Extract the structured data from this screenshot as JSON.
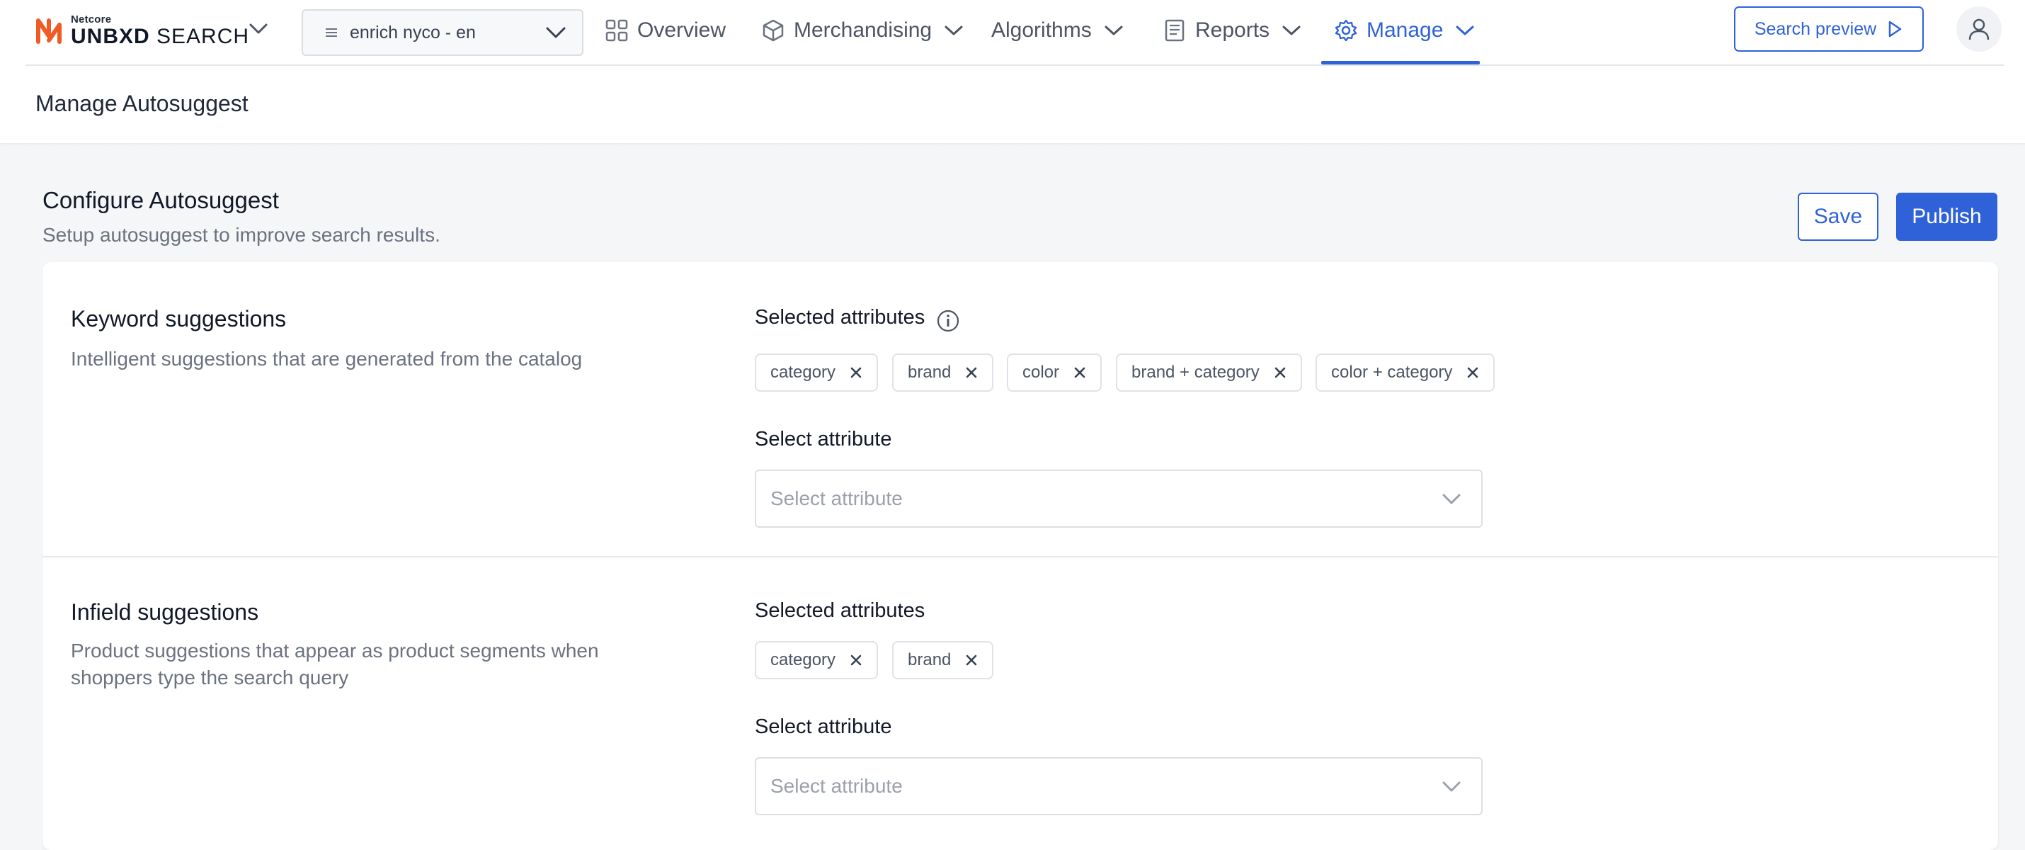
{
  "header": {
    "logo_small": "Netcore",
    "logo_brand_bold": "UNBXD",
    "logo_brand_light": "SEARCH",
    "site_selector": "enrich nyco - en",
    "nav": [
      "Overview",
      "Merchandising",
      "Algorithms",
      "Reports",
      "Manage"
    ],
    "active_nav": "Manage",
    "search_preview": "Search preview"
  },
  "page": {
    "title": "Manage Autosuggest",
    "section_title": "Configure Autosuggest",
    "section_subtitle": "Setup autosuggest to improve search results.",
    "save": "Save",
    "publish": "Publish"
  },
  "keyword": {
    "title": "Keyword suggestions",
    "description": "Intelligent suggestions that are generated from the catalog",
    "selected_label": "Selected attributes",
    "chips": [
      "category",
      "brand",
      "color",
      "brand + category",
      "color + category"
    ],
    "select_label": "Select attribute",
    "select_placeholder": "Select attribute"
  },
  "infield": {
    "title": "Infield suggestions",
    "description_line1": "Product suggestions that appear as product segments when",
    "description_line2": "shoppers type the search query",
    "selected_label": "Selected attributes",
    "chips": [
      "category",
      "brand"
    ],
    "select_label": "Select attribute",
    "select_placeholder": "Select attribute"
  },
  "colors": {
    "accent": "#2f62d8",
    "logo": "#f15a24"
  }
}
